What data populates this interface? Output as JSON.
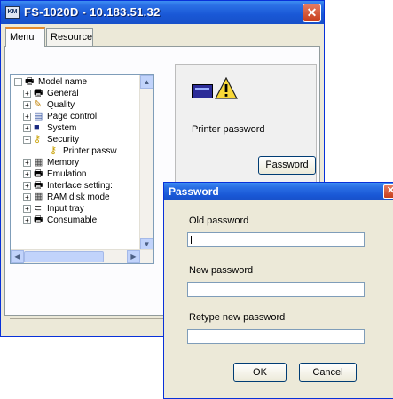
{
  "window": {
    "title": "FS-1020D - 10.183.51.32",
    "app_icon_text": "KM",
    "close_glyph": "✕"
  },
  "tabs": [
    {
      "label": "Menu",
      "active": true
    },
    {
      "label": "Resource",
      "active": false
    }
  ],
  "tree": {
    "items": [
      {
        "label": "Model name",
        "expander": "−",
        "icon": "printer-icon"
      },
      {
        "label": "General",
        "expander": "+",
        "icon": "printer-icon"
      },
      {
        "label": "Quality",
        "expander": "+",
        "icon": "quality-icon"
      },
      {
        "label": "Page control",
        "expander": "+",
        "icon": "page-control-icon"
      },
      {
        "label": "System",
        "expander": "+",
        "icon": "floppy-icon"
      },
      {
        "label": "Security",
        "expander": "−",
        "icon": "key-icon"
      },
      {
        "label": "Printer passw",
        "expander": "",
        "icon": "key-icon"
      },
      {
        "label": "Memory",
        "expander": "+",
        "icon": "memory-icon"
      },
      {
        "label": "Emulation",
        "expander": "+",
        "icon": "printer-icon"
      },
      {
        "label": "Interface setting:",
        "expander": "+",
        "icon": "printer-icon"
      },
      {
        "label": "RAM disk mode",
        "expander": "+",
        "icon": "memory-icon"
      },
      {
        "label": "Input tray",
        "expander": "+",
        "icon": "input-tray-icon"
      },
      {
        "label": "Consumable",
        "expander": "+",
        "icon": "printer-icon"
      }
    ]
  },
  "info_panel": {
    "label": "Printer password",
    "button_label": "Password"
  },
  "dialog": {
    "title": "Password",
    "close_glyph": "✕",
    "fields": [
      {
        "label": "Old password",
        "value": ""
      },
      {
        "label": "New password",
        "value": ""
      },
      {
        "label": "Retype new password",
        "value": ""
      }
    ],
    "ok_label": "OK",
    "cancel_label": "Cancel"
  },
  "colors": {
    "title_blue": "#1958d6",
    "warning_yellow": "#f8d838",
    "close_red": "#c73d1b"
  }
}
